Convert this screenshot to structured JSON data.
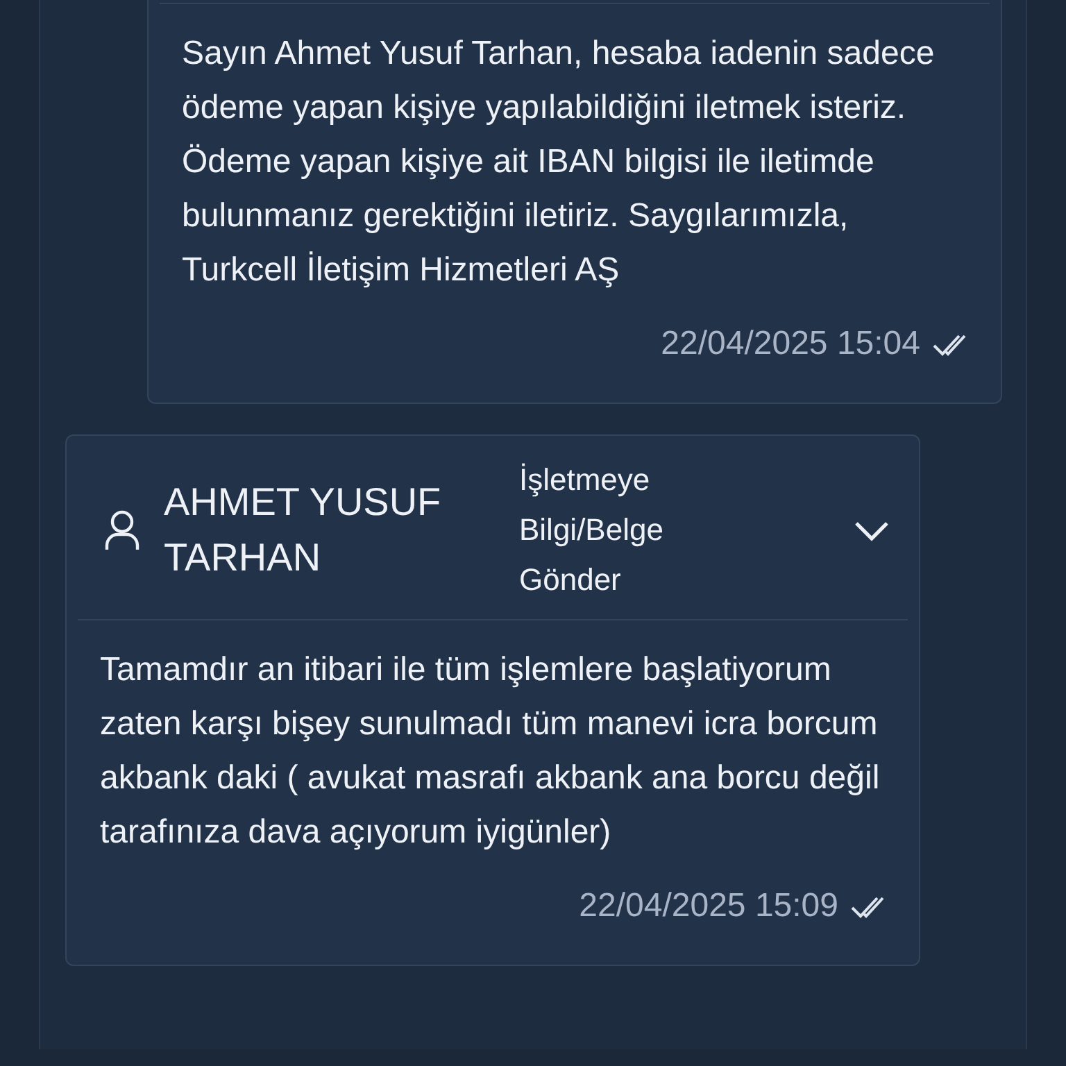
{
  "messages": [
    {
      "kind": "business",
      "body": "Sayın Ahmet Yusuf Tarhan, hesaba iadenin sadece ödeme yapan kişiye yapılabildiğini iletmek isteriz. Ödeme yapan kişiye ait IBAN bilgisi ile iletimde bulunmanız gerektiğini iletiriz. Saygılarımızla, Turkcell İletişim Hizmetleri AŞ",
      "time": "22/04/2025 15:04",
      "read": true
    },
    {
      "kind": "customer",
      "sender": "AHMET YUSUF TARHAN",
      "category": "İşletmeye Bilgi/Belge Gönder",
      "expanded": false,
      "body": "Tamamdır an itibari ile tüm işlemlere başlatiyorum zaten karşı bişey sunulmadı tüm manevi icra borcum akbank daki ( avukat masrafı akbank ana borcu değil tarafınıza dava açıyorum iyigünler)",
      "time": "22/04/2025 15:09",
      "read": true
    }
  ]
}
